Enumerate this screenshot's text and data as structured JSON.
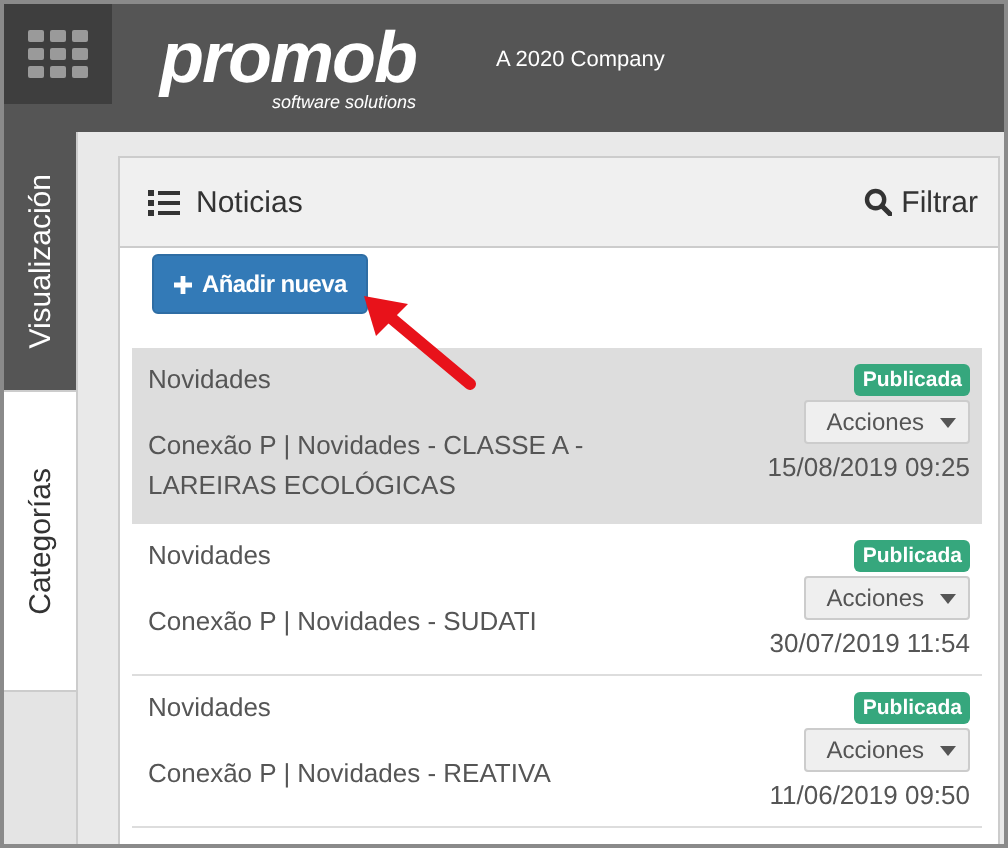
{
  "header": {
    "logo": "promob",
    "logo_tagline": "software solutions",
    "company": "A 2020 Company"
  },
  "side_tabs": [
    {
      "label": "Visualización",
      "selected": true
    },
    {
      "label": "Categorías",
      "selected": false
    }
  ],
  "panel": {
    "title": "Noticias",
    "filter": "Filtrar",
    "add_button": "Añadir nueva"
  },
  "news": [
    {
      "category": "Novidades",
      "title": "Conexão P | Novidades - CLASSE A - LAREIRAS ECOLÓGICAS",
      "status": "Publicada",
      "actions": "Acciones",
      "date": "15/08/2019 09:25",
      "selected": true
    },
    {
      "category": "Novidades",
      "title": "Conexão P | Novidades - SUDATI",
      "status": "Publicada",
      "actions": "Acciones",
      "date": "30/07/2019 11:54",
      "selected": false
    },
    {
      "category": "Novidades",
      "title": "Conexão P | Novidades - REATIVA",
      "status": "Publicada",
      "actions": "Acciones",
      "date": "11/06/2019 09:50",
      "selected": false
    }
  ]
}
